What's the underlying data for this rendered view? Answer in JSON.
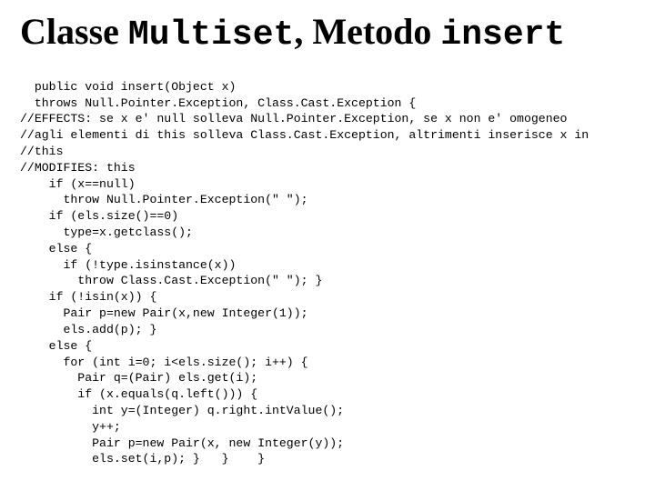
{
  "title": {
    "w1": "Classe ",
    "w2": "Multiset",
    "w3": ", Metodo ",
    "w4": "insert"
  },
  "code": {
    "l01": "  public void insert(Object x)",
    "l02": "  throws Null.Pointer.Exception, Class.Cast.Exception {",
    "l03": "//EFFECTS: se x e' null solleva Null.Pointer.Exception, se x non e' omogeneo",
    "l04": "//agli elementi di this solleva Class.Cast.Exception, altrimenti inserisce x in",
    "l05": "//this",
    "l06": "//MODIFIES: this",
    "l07": "    if (x==null)",
    "l08": "      throw Null.Pointer.Exception(\" \");",
    "l09": "    if (els.size()==0)",
    "l10": "      type=x.getclass();",
    "l11": "    else {",
    "l12": "      if (!type.isinstance(x))",
    "l13": "        throw Class.Cast.Exception(\" \"); }",
    "l14": "    if (!isin(x)) {",
    "l15": "      Pair p=new Pair(x,new Integer(1));",
    "l16": "      els.add(p); }",
    "l17": "    else {",
    "l18": "      for (int i=0; i<els.size(); i++) {",
    "l19": "        Pair q=(Pair) els.get(i);",
    "l20": "        if (x.equals(q.left())) {",
    "l21": "          int y=(Integer) q.right.intValue();",
    "l22": "          y++;",
    "l23": "          Pair p=new Pair(x, new Integer(y));",
    "l24": "          els.set(i,p); }   }    }"
  }
}
